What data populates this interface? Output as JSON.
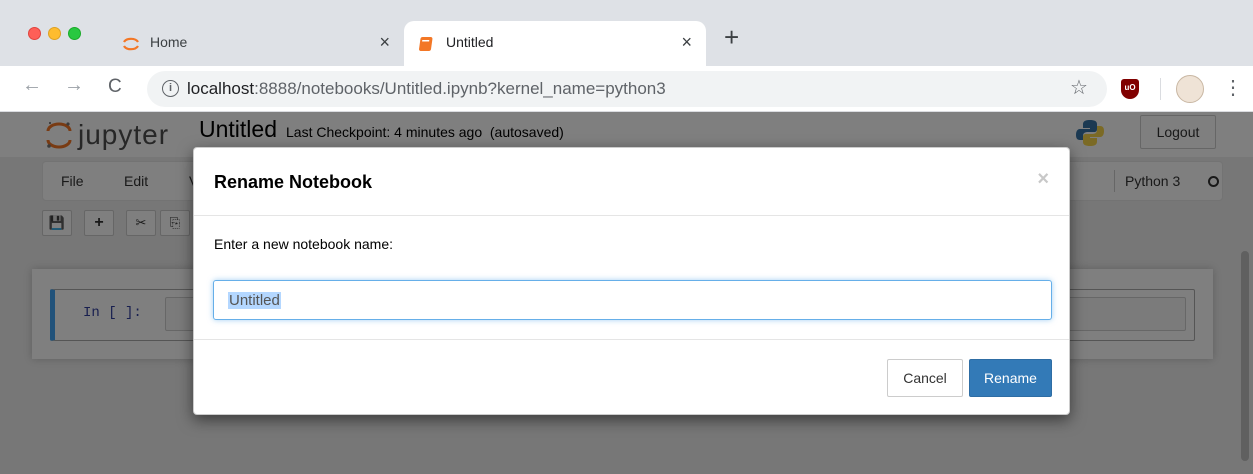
{
  "browser": {
    "tabs": [
      {
        "label": "Home",
        "close": "×"
      },
      {
        "label": "Untitled",
        "close": "×"
      }
    ],
    "new_tab": "+",
    "url_host": "localhost",
    "url_path": ":8888/notebooks/Untitled.ipynb?kernel_name=python3",
    "info_glyph": "i",
    "back_glyph": "←",
    "forward_glyph": "→",
    "reload_glyph": "C",
    "star_glyph": "☆",
    "menu_glyph": "⋮",
    "extension": "uO"
  },
  "jupyter": {
    "logo_text": "jupyter",
    "notebook_name": "Untitled",
    "checkpoint": "Last Checkpoint: 4 minutes ago  (autosaved)",
    "logout_label": "Logout",
    "menu": [
      "File",
      "Edit",
      "V"
    ],
    "kernel_name": "Python 3",
    "toolbar_buttons": [
      "💾",
      "+",
      "✂",
      "⎘"
    ],
    "cell_prompt": "In [ ]:"
  },
  "dialog": {
    "title": "Rename Notebook",
    "close_glyph": "×",
    "prompt_label": "Enter a new notebook name:",
    "input_value": "Untitled",
    "cancel_label": "Cancel",
    "rename_label": "Rename"
  },
  "colors": {
    "jupyter_orange": "#f37726",
    "primary_button": "#337ab7",
    "cell_selected_border": "#42a5f5"
  }
}
